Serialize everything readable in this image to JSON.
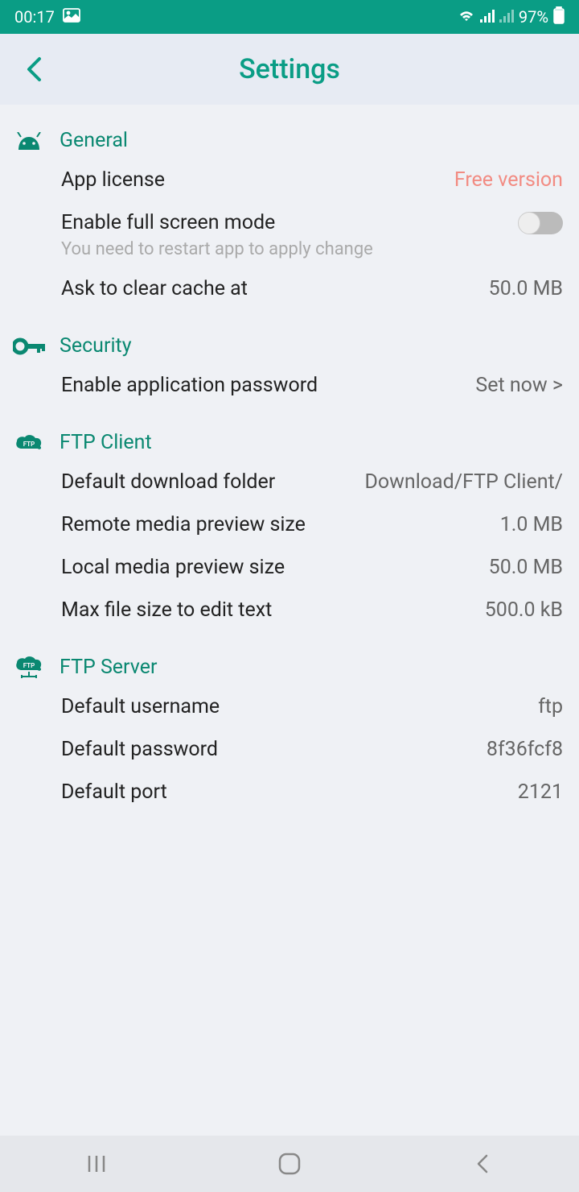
{
  "statusBar": {
    "time": "00:17",
    "battery": "97%"
  },
  "header": {
    "title": "Settings"
  },
  "general": {
    "title": "General",
    "license": {
      "label": "App license",
      "value": "Free version"
    },
    "fullscreen": {
      "label": "Enable full screen mode",
      "hint": "You need to restart app to apply change"
    },
    "cache": {
      "label": "Ask to clear cache at",
      "value": "50.0 MB"
    }
  },
  "security": {
    "title": "Security",
    "password": {
      "label": "Enable application password",
      "value": "Set now >"
    }
  },
  "ftpClient": {
    "title": "FTP Client",
    "downloadFolder": {
      "label": "Default download folder",
      "value": "Download/FTP Client/"
    },
    "remotePreview": {
      "label": "Remote media preview size",
      "value": "1.0 MB"
    },
    "localPreview": {
      "label": "Local media preview size",
      "value": "50.0 MB"
    },
    "maxEdit": {
      "label": "Max file size to edit text",
      "value": "500.0 kB"
    }
  },
  "ftpServer": {
    "title": "FTP Server",
    "username": {
      "label": "Default username",
      "value": "ftp"
    },
    "password": {
      "label": "Default password",
      "value": "8f36fcf8"
    },
    "port": {
      "label": "Default port",
      "value": "2121"
    }
  }
}
